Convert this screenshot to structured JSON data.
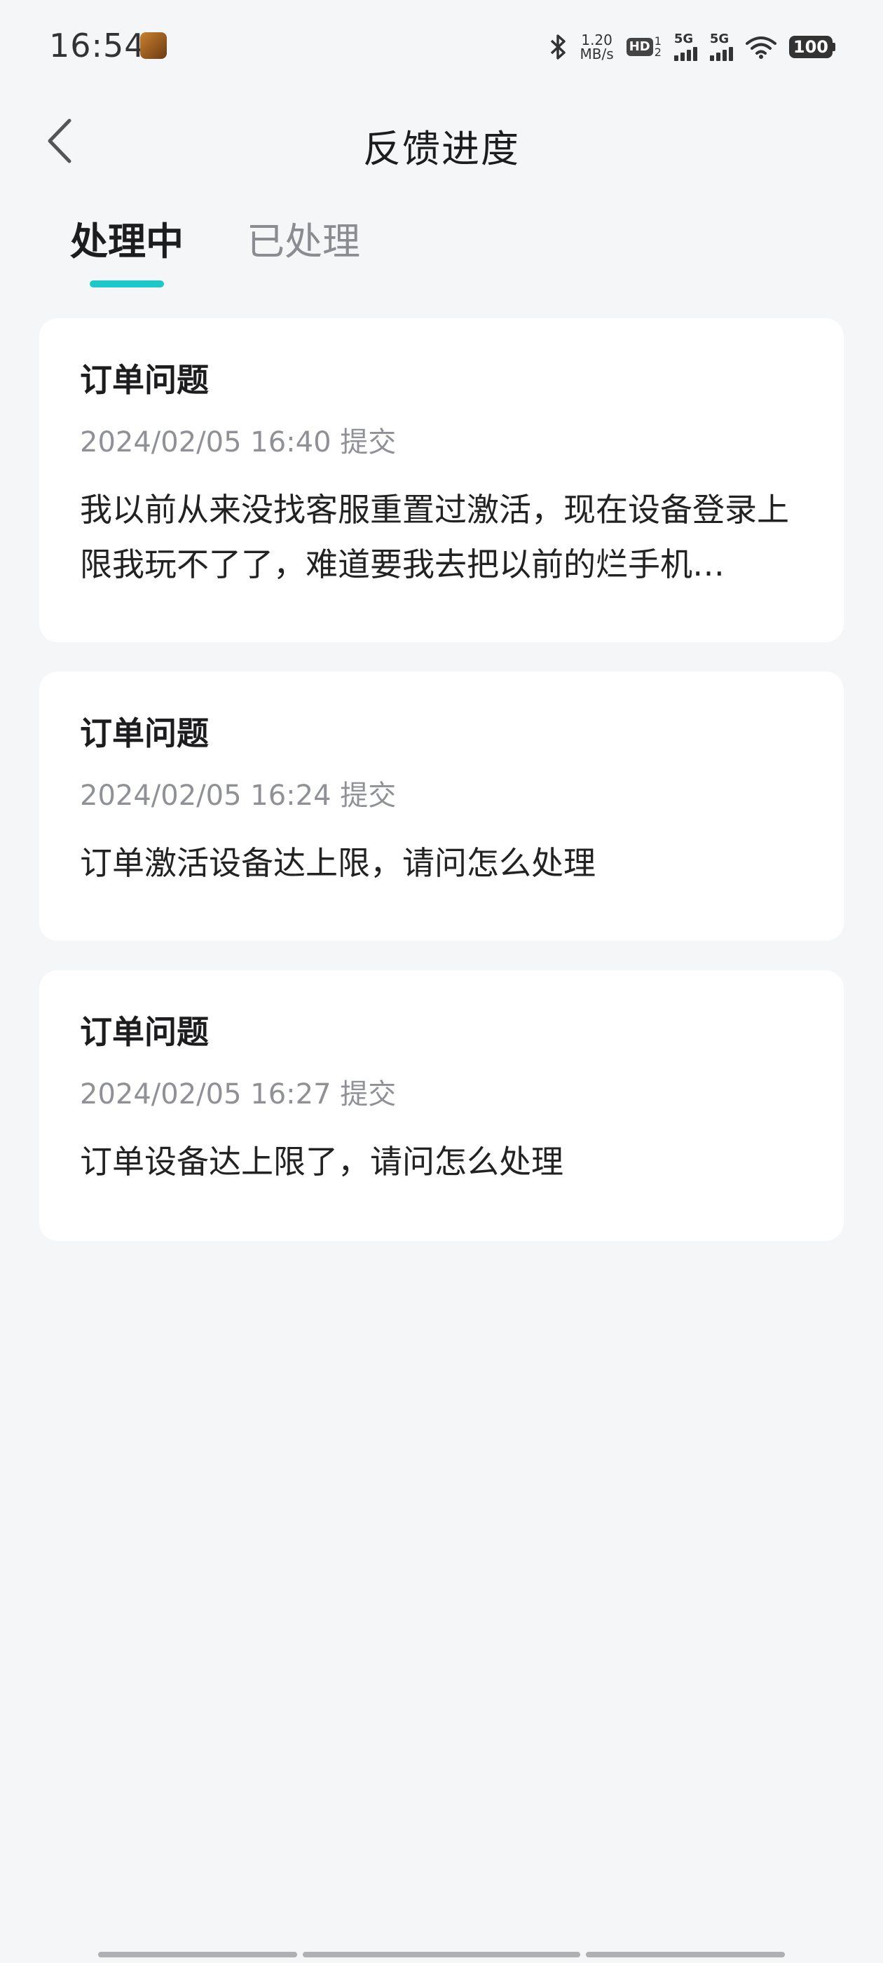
{
  "status_bar": {
    "time": "16:54",
    "net_speed_value": "1.20",
    "net_speed_unit": "MB/s",
    "hd_label": "HD",
    "hd_sub": "1",
    "hd_sub2": "2",
    "signal1_label": "5G",
    "signal2_label": "5G",
    "battery": "100",
    "icons": [
      "app-icon",
      "bluetooth-icon",
      "hd-icon",
      "signal-icon",
      "wifi-icon",
      "battery-icon"
    ]
  },
  "header": {
    "title": "反馈进度",
    "back_icon": "chevron-left-icon"
  },
  "tabs": [
    {
      "label": "处理中",
      "active": true
    },
    {
      "label": "已处理",
      "active": false
    }
  ],
  "accent_color": "#1ec7c9",
  "cards": [
    {
      "title": "订单问题",
      "time": "2024/02/05 16:40 提交",
      "content": "我以前从来没找客服重置过激活，现在设备登录上限我玩不了了，难道要我去把以前的烂手机…"
    },
    {
      "title": "订单问题",
      "time": "2024/02/05 16:24 提交",
      "content": "订单激活设备达上限，请问怎么处理"
    },
    {
      "title": "订单问题",
      "time": "2024/02/05 16:27 提交",
      "content": "订单设备达上限了，请问怎么处理"
    }
  ]
}
